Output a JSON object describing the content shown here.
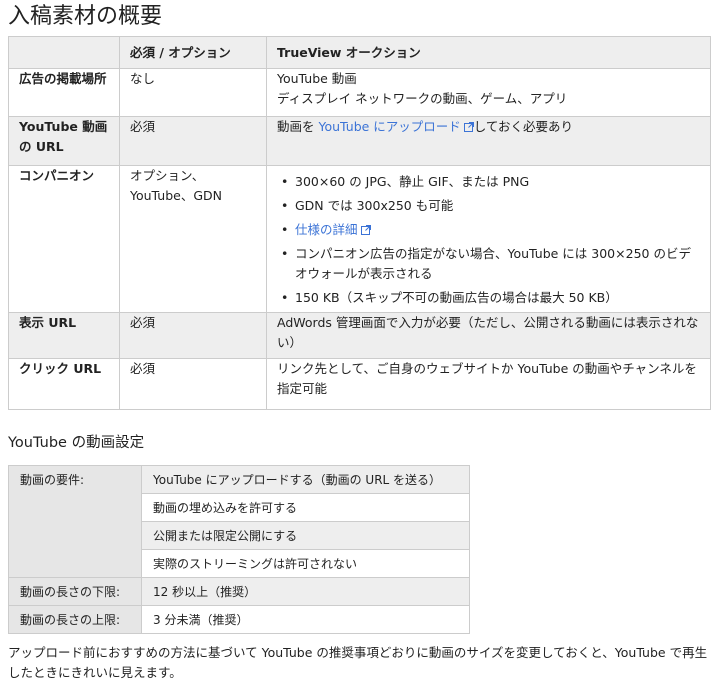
{
  "title": "入稿素材の概要",
  "table": {
    "headers": [
      "",
      "必須 / オプション",
      "TrueView オークション"
    ],
    "rows": {
      "ad_location": {
        "label": "広告の掲載場所",
        "required": "なし",
        "lines": [
          "YouTube 動画",
          "ディスプレイ ネットワークの動画、ゲーム、アプリ"
        ]
      },
      "video_url": {
        "label": "YouTube 動画の URL",
        "required": "必須",
        "before": "動画を ",
        "link": "YouTube にアップロード",
        "after": "しておく必要あり"
      },
      "companion": {
        "label": "コンパニオン",
        "required": "オプション、YouTube、GDN",
        "bullets": {
          "b1": "300×60 の JPG、静止 GIF、または PNG",
          "b2": "GDN では 300x250 も可能",
          "b3_link": "仕様の詳細",
          "b4": "コンパニオン広告の指定がない場合、YouTube には 300×250 のビデオウォールが表示される",
          "b5": "150 KB（スキップ不可の動画広告の場合は最大 50 KB）"
        }
      },
      "display_url": {
        "label": "表示 URL",
        "required": "必須",
        "text": "AdWords 管理画面で入力が必要（ただし、公開される動画には表示されない）"
      },
      "click_url": {
        "label": "クリック URL",
        "required": "必須",
        "text": "リンク先として、ご自身のウェブサイトか YouTube の動画やチャンネルを指定可能"
      }
    }
  },
  "video_settings": {
    "heading": "YouTube の動画設定",
    "requirements_label": "動画の要件:",
    "requirements": [
      "YouTube にアップロードする（動画の URL を送る）",
      "動画の埋め込みを許可する",
      "公開または限定公開にする",
      "実際のストリーミングは許可されない"
    ],
    "min_label": "動画の長さの下限:",
    "min_value": "12 秒以上（推奨）",
    "max_label": "動画の長さの上限:",
    "max_value": "3 分未満（推奨）"
  },
  "note": "アップロード前におすすめの方法に基づいて YouTube の推奨事項どおりに動画のサイズを変更しておくと、YouTube で再生したときにきれいに見えます。",
  "colors": {
    "link": "#3b73d6",
    "header_bg": "#eeeeee",
    "border": "#cccccc"
  },
  "icons": {
    "external": "external-link-icon"
  }
}
